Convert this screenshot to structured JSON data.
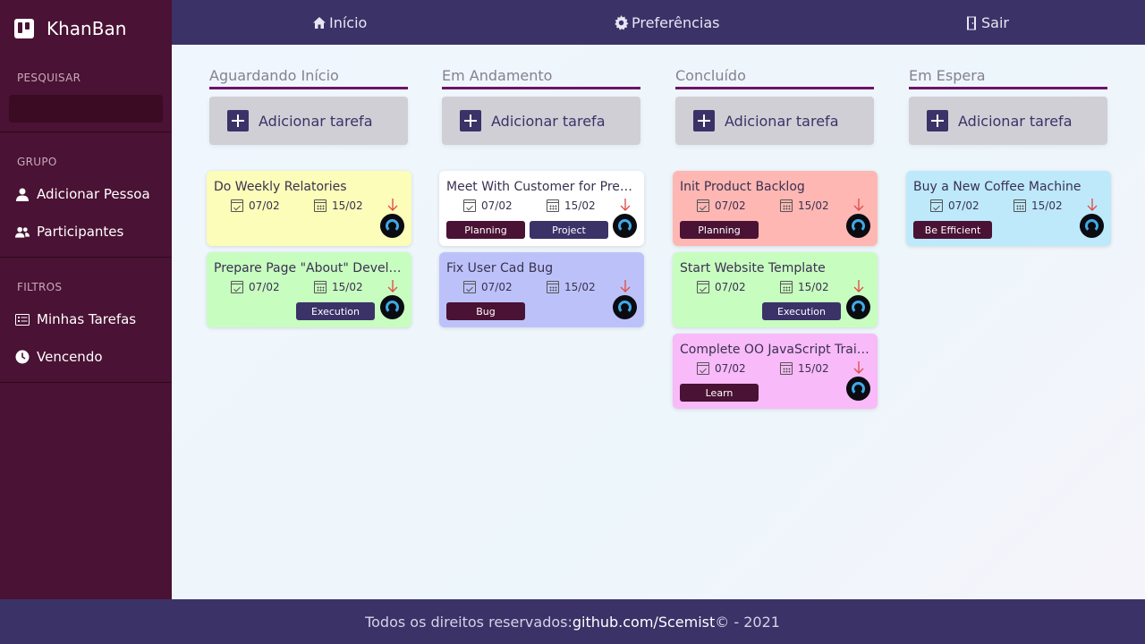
{
  "app": {
    "title": "KhanBan"
  },
  "sidebar": {
    "search_label": "PESQUISAR",
    "search_placeholder": "",
    "group_label": "GRUPO",
    "group_items": [
      {
        "label": "Adicionar Pessoa",
        "icon": "person-icon"
      },
      {
        "label": "Participantes",
        "icon": "people-icon"
      }
    ],
    "filters_label": "FILTROS",
    "filter_items": [
      {
        "label": "Minhas Tarefas",
        "icon": "task-list-icon"
      },
      {
        "label": "Vencendo",
        "icon": "clock-icon"
      }
    ]
  },
  "topbar": {
    "home_label": "Início",
    "prefs_label": "Preferências",
    "logout_label": "Sair"
  },
  "board": {
    "add_task_label": "Adicionar tarefa",
    "columns": [
      {
        "title": "Aguardando Início",
        "cards": [
          {
            "title": "Do Weekly Relatories",
            "start": "07/02",
            "due": "15/02",
            "color": "#fbfdb8",
            "tags": []
          },
          {
            "title": "Prepare Page \"About\" Development",
            "start": "07/02",
            "due": "15/02",
            "color": "#c8fdc0",
            "tags": [
              "Execution"
            ]
          }
        ]
      },
      {
        "title": "Em Andamento",
        "cards": [
          {
            "title": "Meet With Customer for Presentation",
            "start": "07/02",
            "due": "15/02",
            "color": "#ffffff",
            "tags": [
              "Planning",
              "Project"
            ]
          },
          {
            "title": "Fix User Cad Bug",
            "start": "07/02",
            "due": "15/02",
            "color": "#bcc2f9",
            "tags": [
              "Bug"
            ]
          }
        ]
      },
      {
        "title": "Concluído",
        "cards": [
          {
            "title": "Init Product Backlog",
            "start": "07/02",
            "due": "15/02",
            "color": "#feb7b3",
            "tags": [
              "Planning"
            ]
          },
          {
            "title": "Start Website Template",
            "start": "07/02",
            "due": "15/02",
            "color": "#c8fdc0",
            "tags": [
              "Execution"
            ]
          },
          {
            "title": "Complete OO JavaScript Training",
            "start": "07/02",
            "due": "15/02",
            "color": "#f8baf8",
            "tags": [
              "Learn"
            ]
          }
        ]
      },
      {
        "title": "Em Espera",
        "cards": [
          {
            "title": "Buy a New Coffee Machine",
            "start": "07/02",
            "due": "15/02",
            "color": "#bde9fb",
            "tags": [
              "Be Efficient"
            ]
          }
        ]
      }
    ]
  },
  "footer": {
    "prefix": "Todos os direitos reservados: ",
    "link": "github.com/Scemist",
    "suffix": "© - 2021"
  },
  "colors": {
    "sidebar": "#4a1234",
    "topbar": "#3b3268",
    "priority_arrow": "#e0524e",
    "avatar_ring": "#3fa9e6"
  }
}
